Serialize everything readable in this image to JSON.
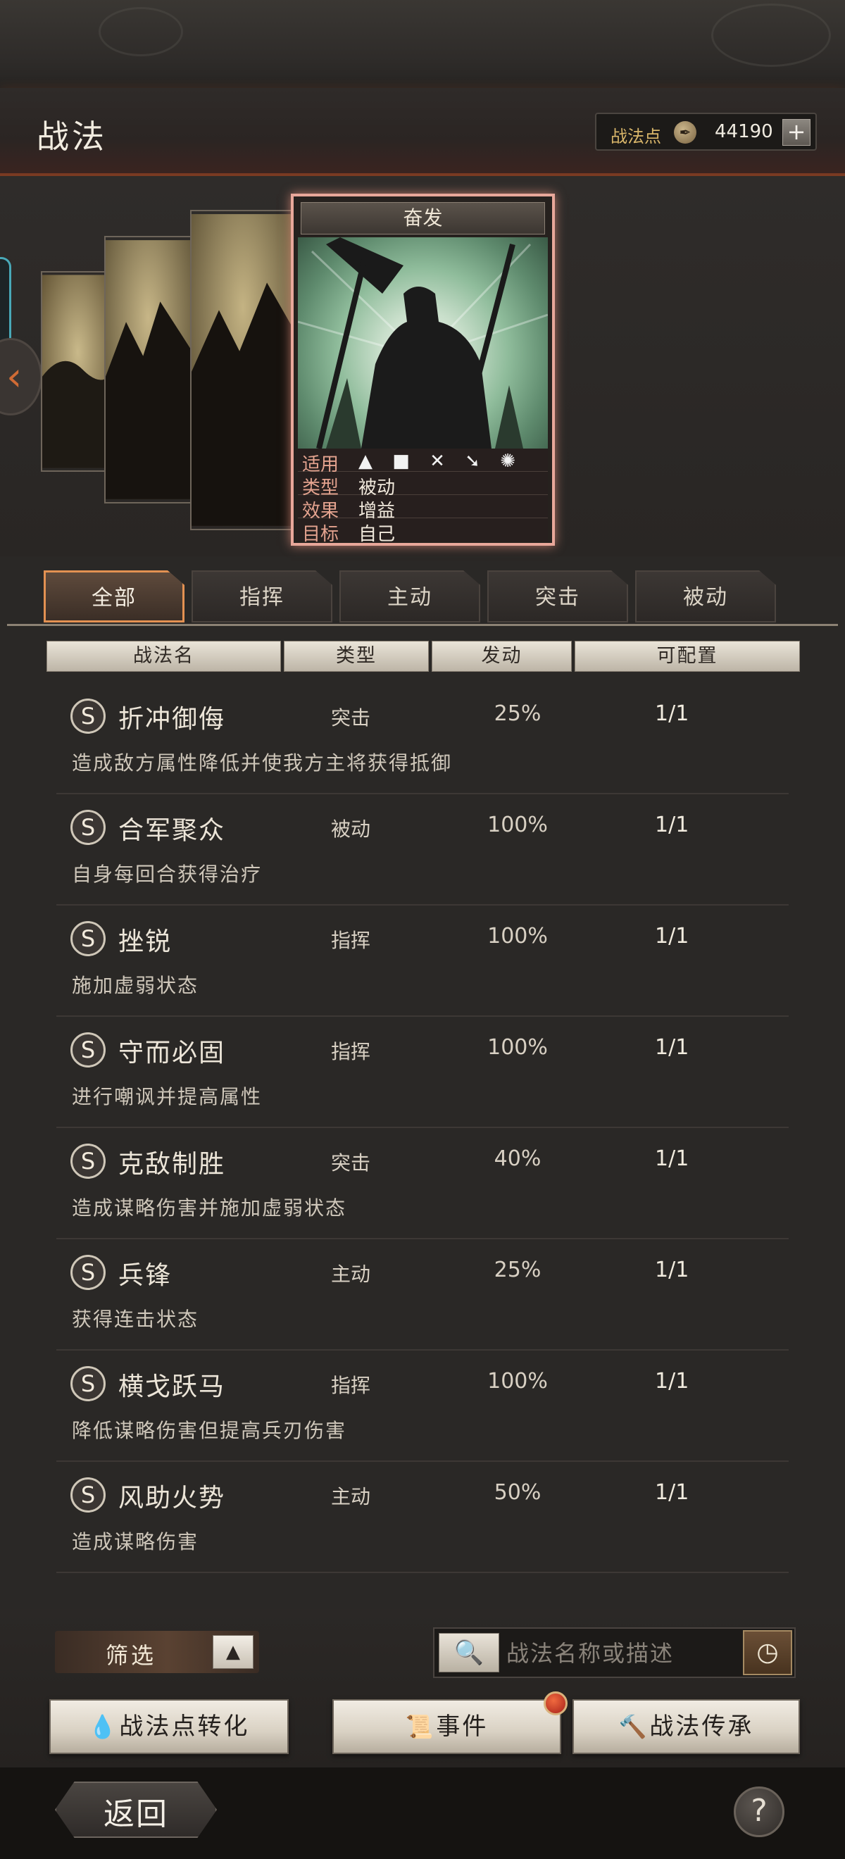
{
  "header": {
    "title": "战法",
    "points_label": "战法点",
    "points_value": "44190",
    "points_icon": "quill-coin-icon",
    "add_icon": "+"
  },
  "selected_card": {
    "name": "奋发",
    "stats": [
      {
        "key": "适用",
        "icons": "▲ ■ ✕ ➘ ✺"
      },
      {
        "key": "类型",
        "value": "被动"
      },
      {
        "key": "效果",
        "value": "增益"
      },
      {
        "key": "目标",
        "value": "自己"
      }
    ]
  },
  "tabs": [
    {
      "label": "全部",
      "active": true
    },
    {
      "label": "指挥",
      "active": false
    },
    {
      "label": "主动",
      "active": false
    },
    {
      "label": "突击",
      "active": false
    },
    {
      "label": "被动",
      "active": false
    }
  ],
  "columns": [
    "战法名",
    "类型",
    "发动",
    "可配置"
  ],
  "rows": [
    {
      "grade": "S",
      "name": "折冲御侮",
      "type": "突击",
      "rate": "25%",
      "avail": "1/1",
      "desc": "造成敌方属性降低并使我方主将获得抵御"
    },
    {
      "grade": "S",
      "name": "合军聚众",
      "type": "被动",
      "rate": "100%",
      "avail": "1/1",
      "desc": "自身每回合获得治疗"
    },
    {
      "grade": "S",
      "name": "挫锐",
      "type": "指挥",
      "rate": "100%",
      "avail": "1/1",
      "desc": "施加虚弱状态"
    },
    {
      "grade": "S",
      "name": "守而必固",
      "type": "指挥",
      "rate": "100%",
      "avail": "1/1",
      "desc": "进行嘲讽并提高属性"
    },
    {
      "grade": "S",
      "name": "克敌制胜",
      "type": "突击",
      "rate": "40%",
      "avail": "1/1",
      "desc": "造成谋略伤害并施加虚弱状态"
    },
    {
      "grade": "S",
      "name": "兵锋",
      "type": "主动",
      "rate": "25%",
      "avail": "1/1",
      "desc": "获得连击状态"
    },
    {
      "grade": "S",
      "name": "横戈跃马",
      "type": "指挥",
      "rate": "100%",
      "avail": "1/1",
      "desc": "降低谋略伤害但提高兵刃伤害"
    },
    {
      "grade": "S",
      "name": "风助火势",
      "type": "主动",
      "rate": "50%",
      "avail": "1/1",
      "desc": "造成谋略伤害"
    }
  ],
  "filter": {
    "label": "筛选",
    "toggle_icon": "▲"
  },
  "search": {
    "placeholder": "战法名称或描述",
    "search_icon": "🔍",
    "history_icon": "◷"
  },
  "actions": {
    "convert": {
      "icon": "💧",
      "label": "战法点转化"
    },
    "events": {
      "icon": "📜",
      "label": "事件"
    },
    "inherit": {
      "icon": "🔨",
      "label": "战法传承"
    }
  },
  "footer": {
    "back_label": "返回",
    "help_icon": "?"
  }
}
